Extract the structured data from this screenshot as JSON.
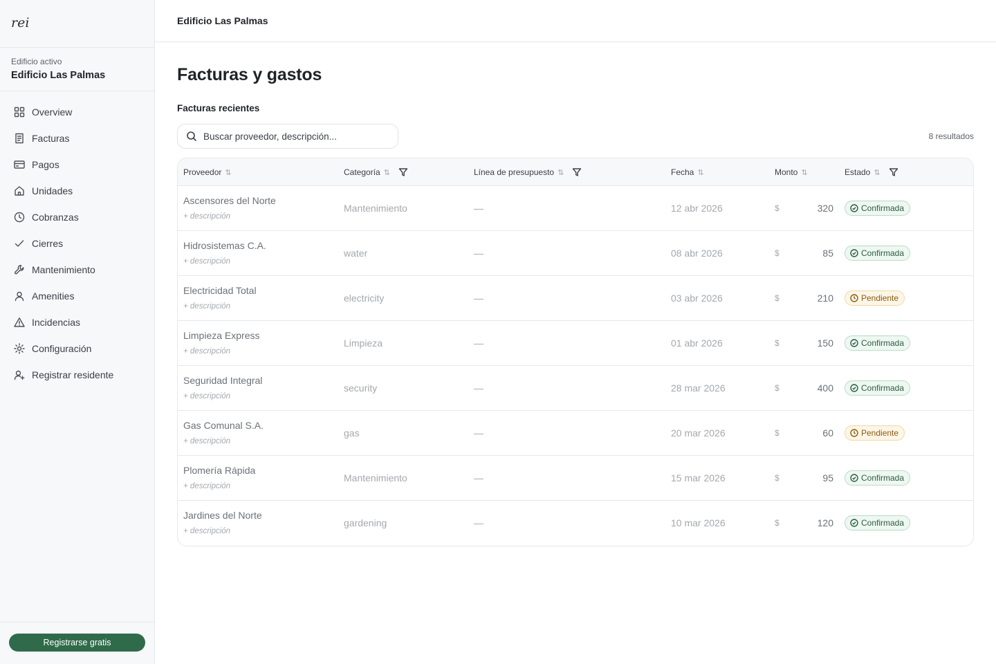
{
  "app": {
    "logo": "rei"
  },
  "sidebar": {
    "building_label": "Edificio activo",
    "building_name": "Edificio Las Palmas",
    "items": [
      {
        "label": "Overview",
        "icon": "grid-icon"
      },
      {
        "label": "Facturas",
        "icon": "receipt-icon"
      },
      {
        "label": "Pagos",
        "icon": "credit-card-icon"
      },
      {
        "label": "Unidades",
        "icon": "home-icon"
      },
      {
        "label": "Cobranzas",
        "icon": "clock-icon"
      },
      {
        "label": "Cierres",
        "icon": "check-icon"
      },
      {
        "label": "Mantenimiento",
        "icon": "wrench-icon"
      },
      {
        "label": "Amenities",
        "icon": "user-icon"
      },
      {
        "label": "Incidencias",
        "icon": "warning-icon"
      },
      {
        "label": "Configuración",
        "icon": "sun-gear-icon"
      },
      {
        "label": "Registrar residente",
        "icon": "user-plus-icon"
      }
    ],
    "cta": "Registrarse gratis"
  },
  "topbar": {
    "title": "Edificio Las Palmas"
  },
  "main": {
    "title": "Facturas y gastos",
    "section_title": "Facturas recientes",
    "search_placeholder": "Buscar proveedor, descripción...",
    "results": "8 resultados",
    "columns": {
      "proveedor": "Proveedor",
      "categoria": "Categoría",
      "linea": "Línea de presupuesto",
      "fecha": "Fecha",
      "monto": "Monto",
      "estado": "Estado"
    },
    "rows": [
      {
        "proveedor": "Ascensores del Norte",
        "descripcion": "+ descripción",
        "categoria": "Mantenimiento",
        "linea": "—",
        "fecha": "12 abr 2026",
        "moneda": "$",
        "monto": "320",
        "estado": "Confirmada",
        "estado_tipo": "ok"
      },
      {
        "proveedor": "Hidrosistemas C.A.",
        "descripcion": "+ descripción",
        "categoria": "water",
        "linea": "—",
        "fecha": "08 abr 2026",
        "moneda": "$",
        "monto": "85",
        "estado": "Confirmada",
        "estado_tipo": "ok"
      },
      {
        "proveedor": "Electricidad Total",
        "descripcion": "+ descripción",
        "categoria": "electricity",
        "linea": "—",
        "fecha": "03 abr 2026",
        "moneda": "$",
        "monto": "210",
        "estado": "Pendiente",
        "estado_tipo": "pend"
      },
      {
        "proveedor": "Limpieza Express",
        "descripcion": "+ descripción",
        "categoria": "Limpieza",
        "linea": "—",
        "fecha": "01 abr 2026",
        "moneda": "$",
        "monto": "150",
        "estado": "Confirmada",
        "estado_tipo": "ok"
      },
      {
        "proveedor": "Seguridad Integral",
        "descripcion": "+ descripción",
        "categoria": "security",
        "linea": "—",
        "fecha": "28 mar 2026",
        "moneda": "$",
        "monto": "400",
        "estado": "Confirmada",
        "estado_tipo": "ok"
      },
      {
        "proveedor": "Gas Comunal S.A.",
        "descripcion": "+ descripción",
        "categoria": "gas",
        "linea": "—",
        "fecha": "20 mar 2026",
        "moneda": "$",
        "monto": "60",
        "estado": "Pendiente",
        "estado_tipo": "pend"
      },
      {
        "proveedor": "Plomería Rápida",
        "descripcion": "+ descripción",
        "categoria": "Mantenimiento",
        "linea": "—",
        "fecha": "15 mar 2026",
        "moneda": "$",
        "monto": "95",
        "estado": "Confirmada",
        "estado_tipo": "ok"
      },
      {
        "proveedor": "Jardines del Norte",
        "descripcion": "+ descripción",
        "categoria": "gardening",
        "linea": "—",
        "fecha": "10 mar 2026",
        "moneda": "$",
        "monto": "120",
        "estado": "Confirmada",
        "estado_tipo": "ok"
      }
    ]
  },
  "colors": {
    "accent": "#2f6b4a",
    "confirmed": "#2b5e41",
    "pending": "#8a5b12"
  }
}
